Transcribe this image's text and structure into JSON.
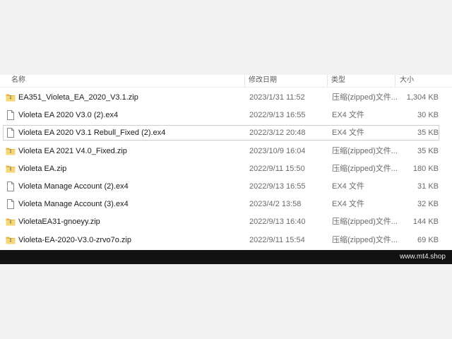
{
  "columns": {
    "name": "名称",
    "date": "修改日期",
    "type": "类型",
    "size": "大小"
  },
  "files": [
    {
      "name": "EA351_Violeta_EA_2020_V3.1.zip",
      "date": "2023/1/31 11:52",
      "type": "压缩(zipped)文件...",
      "size": "1,304 KB",
      "icon": "zip-folder-icon"
    },
    {
      "name": "Violeta EA 2020 V3.0 (2).ex4",
      "date": "2022/9/13 16:55",
      "type": "EX4 文件",
      "size": "30 KB",
      "icon": "file-icon"
    },
    {
      "name": "Violeta EA 2020 V3.1 Rebull_Fixed (2).ex4",
      "date": "2022/3/12 20:48",
      "type": "EX4 文件",
      "size": "35 KB",
      "icon": "file-icon"
    },
    {
      "name": "Violeta EA 2021 V4.0_Fixed.zip",
      "date": "2023/10/9 16:04",
      "type": "压缩(zipped)文件...",
      "size": "35 KB",
      "icon": "zip-folder-icon"
    },
    {
      "name": "Violeta EA.zip",
      "date": "2022/9/11 15:50",
      "type": "压缩(zipped)文件...",
      "size": "180 KB",
      "icon": "zip-folder-icon"
    },
    {
      "name": "Violeta Manage Account (2).ex4",
      "date": "2022/9/13 16:55",
      "type": "EX4 文件",
      "size": "31 KB",
      "icon": "file-icon"
    },
    {
      "name": "Violeta Manage Account (3).ex4",
      "date": "2023/4/2 13:58",
      "type": "EX4 文件",
      "size": "32 KB",
      "icon": "file-icon"
    },
    {
      "name": "VioletaEA31-gnoeyy.zip",
      "date": "2022/9/13 16:40",
      "type": "压缩(zipped)文件...",
      "size": "144 KB",
      "icon": "zip-folder-icon"
    },
    {
      "name": "Violeta-EA-2020-V3.0-zrvo7o.zip",
      "date": "2022/9/11 15:54",
      "type": "压缩(zipped)文件...",
      "size": "69 KB",
      "icon": "zip-folder-icon"
    }
  ],
  "selected_index": 2,
  "watermark": "www.mt4.shop",
  "colors": {
    "folder_yellow": "#e8b53a",
    "folder_light": "#f6d774",
    "footer_bg": "#121212"
  }
}
